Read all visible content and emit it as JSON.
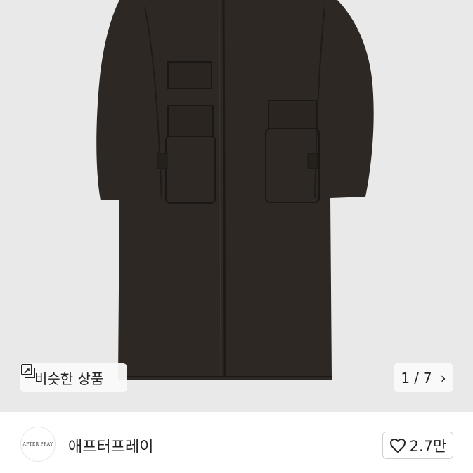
{
  "gallery": {
    "similar_label": "비슷한 상품",
    "current_index": "1",
    "separator": "/",
    "total": "7",
    "next_chevron": "›",
    "icons": {
      "similar": "similar-items-icon",
      "next": "chevron-right-icon"
    }
  },
  "seller": {
    "logo_text": "AFTER PRAY",
    "name": "애프터프레이",
    "likes": "2.7만",
    "icons": {
      "like": "heart-icon"
    }
  },
  "colors": {
    "photo_bg": "#e9e9e9",
    "coat": "#2d2823",
    "text": "#222222"
  }
}
